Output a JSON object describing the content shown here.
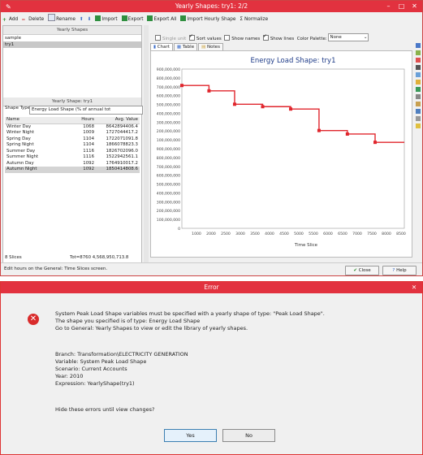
{
  "main_window": {
    "title": "Yearly Shapes: try1: 2/2",
    "toolbar": [
      "Add",
      "Delete",
      "Rename",
      "Import",
      "Export",
      "Export All",
      "Import Hourly Shape",
      "Normalize"
    ],
    "left_header": "Yearly Shapes",
    "shapes": [
      "sample",
      "try1"
    ],
    "selected_shape": "try1",
    "shapes_of_header": "Yearly Shape: try1",
    "shape_type_label": "Shape Type:",
    "shape_type_value": "Energy Load Shape (% of annual tot",
    "table_headers": [
      "Name",
      "Hours",
      "Avg. Value"
    ],
    "rows": [
      {
        "name": "Winter Day",
        "hours": "1068",
        "value": "8642894406.4"
      },
      {
        "name": "Winter Night",
        "hours": "1009",
        "value": "1727044417.2"
      },
      {
        "name": "Spring Day",
        "hours": "1104",
        "value": "1722071091.8"
      },
      {
        "name": "Spring Night",
        "hours": "1104",
        "value": "1866078823.3"
      },
      {
        "name": "Summer Day",
        "hours": "1116",
        "value": "1826702096.0"
      },
      {
        "name": "Summer Night",
        "hours": "1116",
        "value": "1522942561.1"
      },
      {
        "name": "Autumn Day",
        "hours": "1092",
        "value": "1764910017.2"
      },
      {
        "name": "Autumn Night",
        "hours": "1092",
        "value": "1850414808.6"
      }
    ],
    "selected_row": "Autumn Night",
    "footer_count": "8 Slices",
    "footer_total": "Tot=8760  4,568,950,713.8",
    "options": {
      "single_unit": "Single unit",
      "sort_values": "Sort values",
      "show_names": "Show names",
      "show_lines": "Show lines",
      "color_palette_label": "Color Palette:",
      "color_palette_value": "None"
    },
    "tabs": [
      "Chart",
      "Table",
      "Notes"
    ],
    "status_text": "Edit hours on the General: Time Slices screen.",
    "close_button": "Close",
    "help_button": "Help"
  },
  "chart_data": {
    "type": "line",
    "title": "Energy Load Shape: try1",
    "xlabel": "Time Slice",
    "ylabel": "",
    "y_ticks": [
      "900,000,000",
      "800,000,000",
      "700,000,000",
      "600,000,000",
      "500,000,000",
      "400,000,000",
      "300,000,000",
      "200,000,000",
      "100,000,000",
      "900,000,000",
      "800,000,000",
      "700,000,000",
      "600,000,000",
      "500,000,000",
      "400,000,000",
      "300,000,000",
      "200,000,000",
      "100,000,000",
      "0"
    ],
    "x_ticks": [
      "1000",
      "2000",
      "2500",
      "3000",
      "3500",
      "4000",
      "4500",
      "5000",
      "5500",
      "6000",
      "6500",
      "7000",
      "7500",
      "8000",
      "8500"
    ],
    "x": [
      0,
      1068,
      2077,
      3181,
      4285,
      5401,
      6517,
      7609,
      8760
    ],
    "values": [
      897,
      863,
      779,
      764,
      749,
      614,
      592,
      540,
      540
    ],
    "color": "#e0262d"
  },
  "error_dialog": {
    "title": "Error",
    "lines": [
      "System Peak Load Shape variables must be specified with a yearly shape of type: \"Peak Load Shape\".",
      "The shape you specified is of type: Energy Load Shape",
      "Go to General: Yearly Shapes to view or edit the library of yearly shapes.",
      "",
      "Branch: Transformation\\ELECTRICITY GENERATION",
      "Variable: System Peak Load Shape",
      "Scenario: Current Accounts",
      "Year: 2010",
      "Expression: YearlyShape(try1)",
      "",
      "Hide these errors until view changes?"
    ],
    "yes": "Yes",
    "no": "No"
  }
}
